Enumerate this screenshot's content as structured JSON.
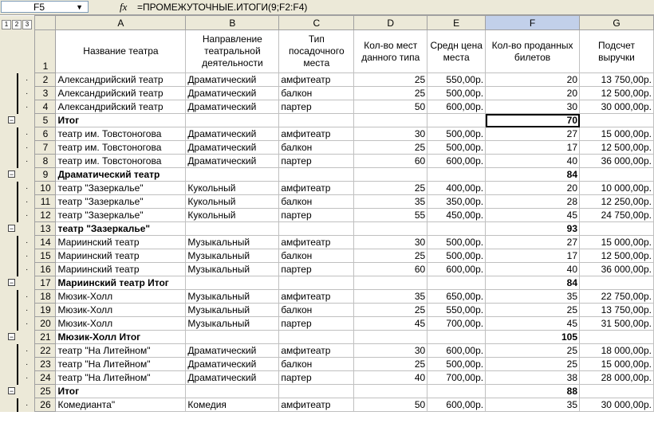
{
  "formula_bar": {
    "name_box": "F5",
    "fx_label": "fx",
    "formula": "=ПРОМЕЖУТОЧНЫЕ.ИТОГИ(9;F2:F4)"
  },
  "outline_levels": [
    "1",
    "2",
    "3"
  ],
  "columns": [
    "A",
    "B",
    "C",
    "D",
    "E",
    "F",
    "G"
  ],
  "header_row": {
    "num": "1",
    "cells": [
      "Название театра",
      "Направление театральной деятельности",
      "Тип посадочного места",
      "Кол-во мест данного типа",
      "Средн цена места",
      "Кол-во проданных билетов",
      "Подсчет выручки"
    ]
  },
  "rows": [
    {
      "num": "2",
      "a": "Александрийский театр",
      "b": "Драматический",
      "c": "амфитеатр",
      "d": "25",
      "e": "550,00р.",
      "f": "20",
      "g": "13 750,00р."
    },
    {
      "num": "3",
      "a": "Александрийский театр",
      "b": "Драматический",
      "c": "балкон",
      "d": "25",
      "e": "500,00р.",
      "f": "20",
      "g": "12 500,00р."
    },
    {
      "num": "4",
      "a": "Александрийский театр",
      "b": "Драматический",
      "c": "партер",
      "d": "50",
      "e": "600,00р.",
      "f": "30",
      "g": "30 000,00р."
    },
    {
      "num": "5",
      "a": "Итог",
      "b": "",
      "c": "",
      "d": "",
      "e": "",
      "f": "70",
      "g": "",
      "total": true
    },
    {
      "num": "6",
      "a": "театр им. Товстоногова",
      "b": "Драматический",
      "c": "амфитеатр",
      "d": "30",
      "e": "500,00р.",
      "f": "27",
      "g": "15 000,00р."
    },
    {
      "num": "7",
      "a": "театр им. Товстоногова",
      "b": "Драматический",
      "c": "балкон",
      "d": "25",
      "e": "500,00р.",
      "f": "17",
      "g": "12 500,00р."
    },
    {
      "num": "8",
      "a": "театр им. Товстоногова",
      "b": "Драматический",
      "c": "партер",
      "d": "60",
      "e": "600,00р.",
      "f": "40",
      "g": "36 000,00р."
    },
    {
      "num": "9",
      "a": "Драматический театр",
      "b": "",
      "c": "",
      "d": "",
      "e": "",
      "f": "84",
      "g": "",
      "total": true
    },
    {
      "num": "10",
      "a": "театр \"Зазеркалье\"",
      "b": "Кукольный",
      "c": "амфитеатр",
      "d": "25",
      "e": "400,00р.",
      "f": "20",
      "g": "10 000,00р."
    },
    {
      "num": "11",
      "a": "театр \"Зазеркалье\"",
      "b": "Кукольный",
      "c": "балкон",
      "d": "35",
      "e": "350,00р.",
      "f": "28",
      "g": "12 250,00р."
    },
    {
      "num": "12",
      "a": "театр \"Зазеркалье\"",
      "b": "Кукольный",
      "c": "партер",
      "d": "55",
      "e": "450,00р.",
      "f": "45",
      "g": "24 750,00р."
    },
    {
      "num": "13",
      "a": "театр \"Зазеркалье\"",
      "b": "",
      "c": "",
      "d": "",
      "e": "",
      "f": "93",
      "g": "",
      "total": true
    },
    {
      "num": "14",
      "a": "Мариинский театр",
      "b": "Музыкальный",
      "c": "амфитеатр",
      "d": "30",
      "e": "500,00р.",
      "f": "27",
      "g": "15 000,00р."
    },
    {
      "num": "15",
      "a": "Мариинский театр",
      "b": "Музыкальный",
      "c": "балкон",
      "d": "25",
      "e": "500,00р.",
      "f": "17",
      "g": "12 500,00р."
    },
    {
      "num": "16",
      "a": "Мариинский театр",
      "b": "Музыкальный",
      "c": "партер",
      "d": "60",
      "e": "600,00р.",
      "f": "40",
      "g": "36 000,00р."
    },
    {
      "num": "17",
      "a": "Мариинский театр Итог",
      "b": "",
      "c": "",
      "d": "",
      "e": "",
      "f": "84",
      "g": "",
      "total": true
    },
    {
      "num": "18",
      "a": "Мюзик-Холл",
      "b": "Музыкальный",
      "c": "амфитеатр",
      "d": "35",
      "e": "650,00р.",
      "f": "35",
      "g": "22 750,00р."
    },
    {
      "num": "19",
      "a": "Мюзик-Холл",
      "b": "Музыкальный",
      "c": "балкон",
      "d": "25",
      "e": "550,00р.",
      "f": "25",
      "g": "13 750,00р."
    },
    {
      "num": "20",
      "a": "Мюзик-Холл",
      "b": "Музыкальный",
      "c": "партер",
      "d": "45",
      "e": "700,00р.",
      "f": "45",
      "g": "31 500,00р."
    },
    {
      "num": "21",
      "a": "Мюзик-Холл Итог",
      "b": "",
      "c": "",
      "d": "",
      "e": "",
      "f": "105",
      "g": "",
      "total": true
    },
    {
      "num": "22",
      "a": "театр \"На Литейном\"",
      "b": "Драматический",
      "c": "амфитеатр",
      "d": "30",
      "e": "600,00р.",
      "f": "25",
      "g": "18 000,00р."
    },
    {
      "num": "23",
      "a": "театр \"На Литейном\"",
      "b": "Драматический",
      "c": "балкон",
      "d": "25",
      "e": "500,00р.",
      "f": "25",
      "g": "15 000,00р."
    },
    {
      "num": "24",
      "a": "театр \"На Литейном\"",
      "b": "Драматический",
      "c": "партер",
      "d": "40",
      "e": "700,00р.",
      "f": "38",
      "g": "28 000,00р."
    },
    {
      "num": "25",
      "a": "Итог",
      "b": "",
      "c": "",
      "d": "",
      "e": "",
      "f": "88",
      "g": "",
      "total": true
    },
    {
      "num": "26",
      "a": "Комедианта\"",
      "b": "Комедия",
      "c": "амфитеатр",
      "d": "50",
      "e": "600,00р.",
      "f": "35",
      "g": "30 000,00р."
    }
  ]
}
